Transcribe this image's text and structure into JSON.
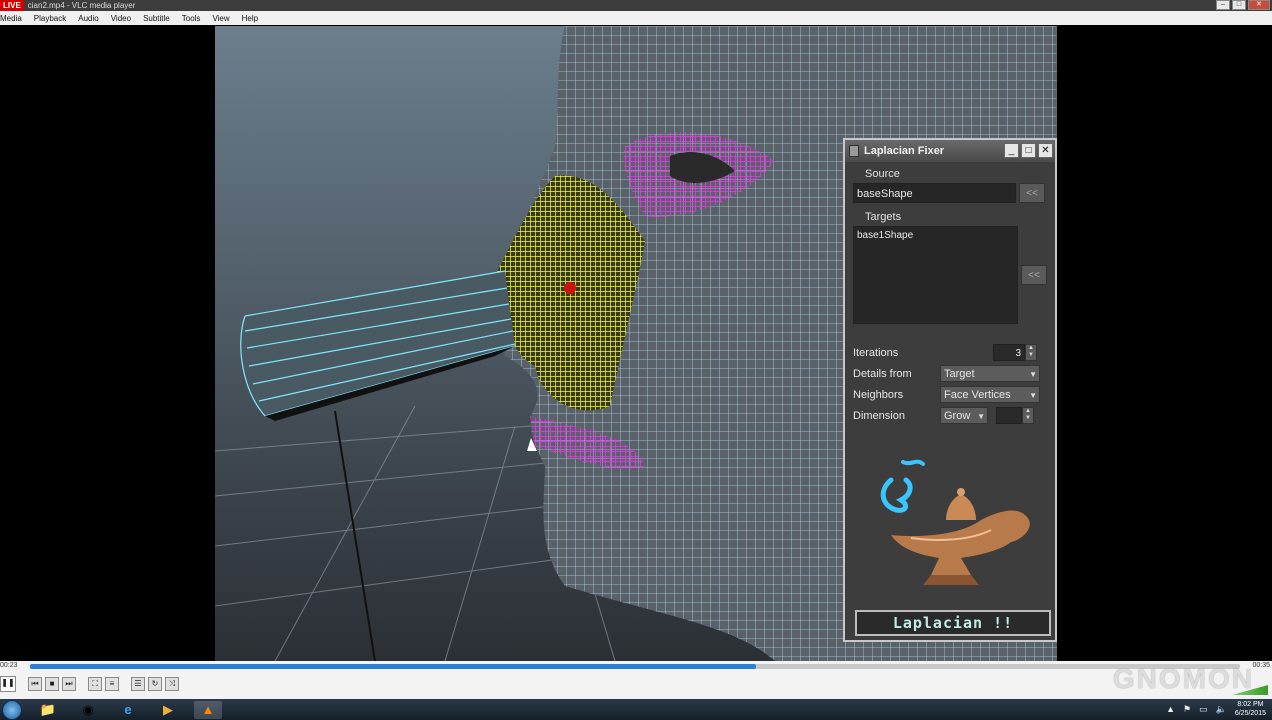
{
  "window": {
    "live_badge": "LIVE",
    "title": "cian2.mp4 - VLC media player"
  },
  "menu": [
    "Media",
    "Playback",
    "Audio",
    "Video",
    "Subtitle",
    "Tools",
    "View",
    "Help"
  ],
  "laplacian": {
    "title": "Laplacian Fixer",
    "source_label": "Source",
    "source_value": "baseShape",
    "source_btn": "<<",
    "targets_label": "Targets",
    "targets_value": "base1Shape",
    "targets_btn": "<<",
    "iterations_label": "Iterations",
    "iterations_value": "3",
    "details_label": "Details from",
    "details_value": "Target",
    "neighbors_label": "Neighbors",
    "neighbors_value": "Face Vertices",
    "dimension_label": "Dimension",
    "dimension_value": "Grow",
    "run_button": "Laplacian !!"
  },
  "player": {
    "elapsed": "00:23",
    "total": "00:35",
    "progress": 0.6,
    "watermark": "GNOMON"
  },
  "taskbar": {
    "clock_time": "8:02 PM",
    "clock_date": "6/25/2015"
  }
}
